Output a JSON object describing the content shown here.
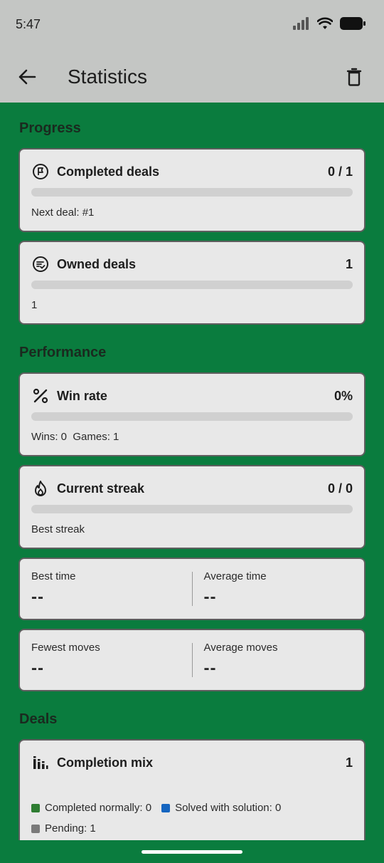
{
  "status_bar": {
    "time": "5:47"
  },
  "app_bar": {
    "title": "Statistics"
  },
  "sections": {
    "progress": "Progress",
    "performance": "Performance",
    "deals": "Deals"
  },
  "cards": {
    "completed_deals": {
      "label": "Completed deals",
      "value": "0 / 1",
      "progress": 0,
      "sub": "Next deal: #1",
      "icon": "flag-circle-icon"
    },
    "owned_deals": {
      "label": "Owned deals",
      "value": "1",
      "progress": 0,
      "sub": "1",
      "icon": "checklist-circle-icon"
    },
    "win_rate": {
      "label": "Win rate",
      "value": "0%",
      "progress": 0,
      "sub": "Wins: 0  Games: 1",
      "icon": "percent-icon"
    },
    "current_streak": {
      "label": "Current streak",
      "value": "0 / 0",
      "progress": 0,
      "sub": "Best streak",
      "icon": "flame-icon"
    }
  },
  "times": {
    "best_label": "Best time",
    "best_value": "--",
    "average_label": "Average time",
    "average_value": "--"
  },
  "moves": {
    "fewest_label": "Fewest moves",
    "fewest_value": "--",
    "average_label": "Average moves",
    "average_value": "--"
  },
  "completion_mix": {
    "label": "Completion mix",
    "value": "1",
    "icon": "bar-chart-icon",
    "legend": [
      {
        "label": "Completed normally: 0",
        "color": "#2e7d32"
      },
      {
        "label": "Solved with solution: 0",
        "color": "#1565c0"
      },
      {
        "label": "Pending: 1",
        "color": "#7a7a7a"
      }
    ]
  },
  "colors": {
    "background": "#0a7c3e",
    "app_bar": "#c4c6c4",
    "card": "#e8e8e8"
  }
}
